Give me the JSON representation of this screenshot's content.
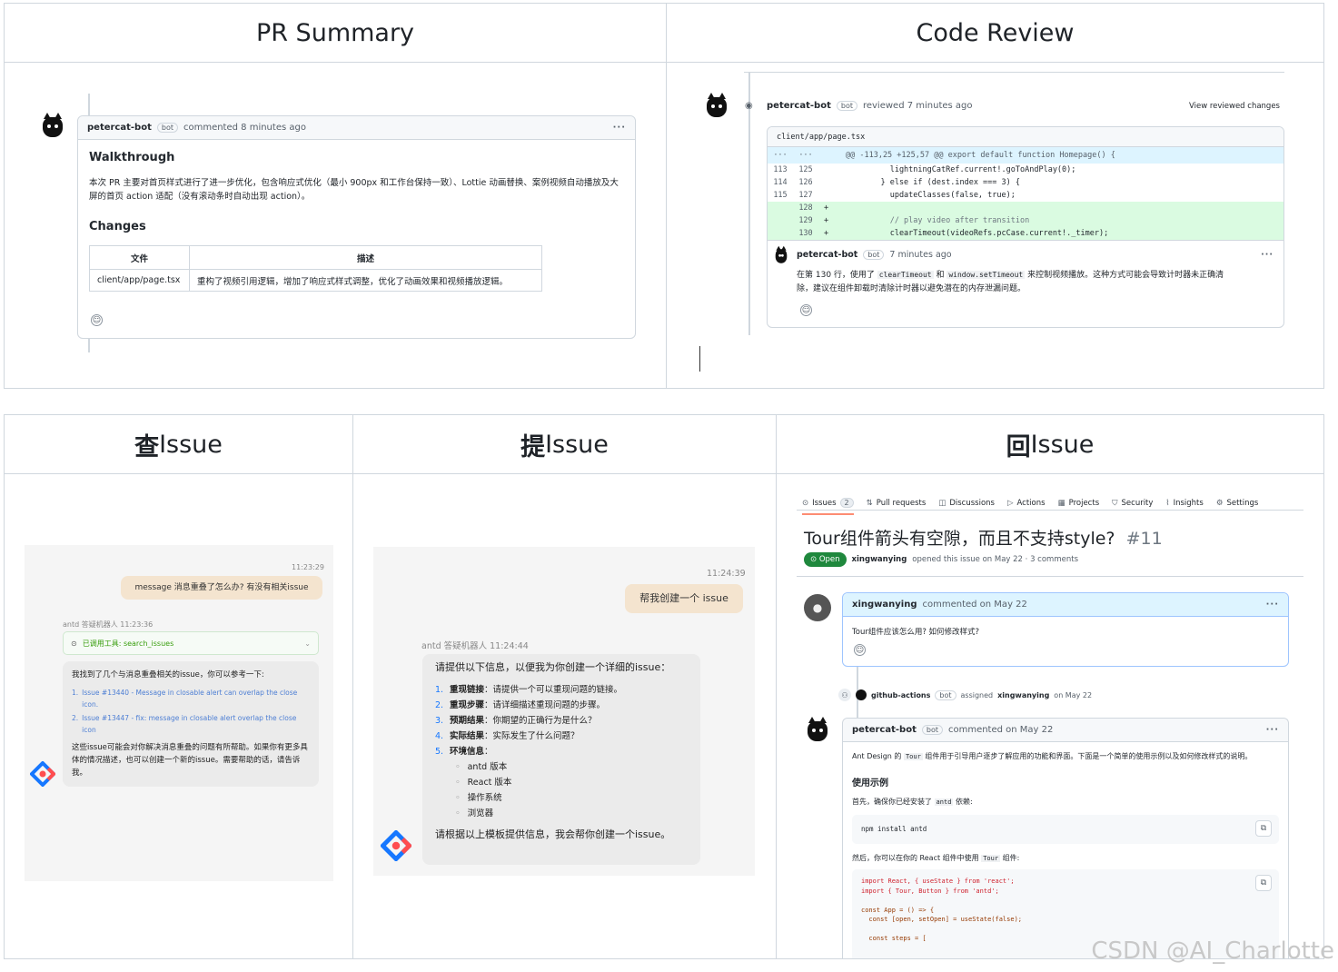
{
  "top": {
    "headers": [
      "PR Summary",
      "Code Review"
    ],
    "pr": {
      "user": "petercat-bot",
      "bot_badge": "bot",
      "action": "commented 8 minutes ago",
      "walkthrough_title": "Walkthrough",
      "walkthrough_text": "本次 PR 主要对首页样式进行了进一步优化，包含响应式优化（最小 900px 和工作台保持一致）、Lottie 动画替换、案例视频自动播放及大屏的首页 action 适配（没有滚动条时自动出现 action）。",
      "changes_title": "Changes",
      "table_headers": [
        "文件",
        "描述"
      ],
      "table_row": [
        "client/app/page.tsx",
        "重构了视频引用逻辑，增加了响应式样式调整，优化了动画效果和视频播放逻辑。"
      ],
      "dots": "···",
      "smile": "☺"
    },
    "review": {
      "user": "petercat-bot",
      "bot_badge": "bot",
      "action": "reviewed 7 minutes ago",
      "view_link": "View reviewed changes",
      "file": "client/app/page.tsx",
      "hunk_left": "···",
      "hunk_right": "···",
      "hunk": "@@ -113,25 +125,57 @@ export default function Homepage() {",
      "lines": [
        {
          "a": "113",
          "b": "125",
          "sign": "",
          "code": "      lightningCatRef.current!.goToAndPlay(0);"
        },
        {
          "a": "114",
          "b": "126",
          "sign": "",
          "code": "    } else if (dest.index === 3) {"
        },
        {
          "a": "115",
          "b": "127",
          "sign": "",
          "code": "      updateClasses(false, true);"
        },
        {
          "a": "",
          "b": "128",
          "sign": "+",
          "code": ""
        },
        {
          "a": "",
          "b": "129",
          "sign": "+",
          "code": "      // play video after transition"
        },
        {
          "a": "",
          "b": "130",
          "sign": "+",
          "code": "      clearTimeout(videoRefs.pcCase.current!._timer);"
        }
      ],
      "comment_user": "petercat-bot",
      "comment_time": "7 minutes ago",
      "comment_text_1": "在第 130 行，使用了",
      "code_a": "clearTimeout",
      "comment_and": "和",
      "code_b": "window.setTimeout",
      "comment_text_2": "来控制视频播放。这种方式可能会导致计时器未正确清",
      "comment_text_3": "除，建议在组件卸载时清除计时器以避免潜在的内存泄漏问题。",
      "dots": "···",
      "smile": "☺"
    }
  },
  "bottom": {
    "headers": [
      {
        "glyph": "查",
        "text": " Issue"
      },
      {
        "glyph": "提",
        "text": " Issue"
      },
      {
        "glyph": "回",
        "text": " Issue"
      }
    ],
    "query": {
      "time_user": "11:23:29",
      "user_msg": "message 消息重叠了怎么办? 有没有相关issue",
      "bot_label": "antd 答疑机器人 11:23:36",
      "tool_label": "已调用工具: search_issues",
      "intro": "我找到了几个与消息重叠相关的issue，你可以参考一下:",
      "items": [
        {
          "num": "1.",
          "text": "Issue #13440 - Message in closable alert can overlap the close icon."
        },
        {
          "num": "2.",
          "text": "Issue #13447 - fix: message in closable alert overlap the close icon"
        }
      ],
      "outro": "这些issue可能会对你解决消息重叠的问题有所帮助。如果你有更多具体的情况描述，也可以创建一个新的issue。需要帮助的话，请告诉我。"
    },
    "create": {
      "time_user": "11:24:39",
      "user_msg": "帮我创建一个 issue",
      "bot_label": "antd 答疑机器人 11:24:44",
      "intro": "请提供以下信息，以便我为你创建一个详细的issue：",
      "items": [
        {
          "num": "1.",
          "bold": "重现链接",
          "text": "：请提供一个可以重现问题的链接。"
        },
        {
          "num": "2.",
          "bold": "重现步骤",
          "text": "：请详细描述重现问题的步骤。"
        },
        {
          "num": "3.",
          "bold": "预期结果",
          "text": "：你期望的正确行为是什么？"
        },
        {
          "num": "4.",
          "bold": "实际结果",
          "text": "：实际发生了什么问题？"
        },
        {
          "num": "5.",
          "bold": "环境信息",
          "text": "："
        }
      ],
      "sub_items": [
        "antd 版本",
        "React 版本",
        "操作系统",
        "浏览器"
      ],
      "outro": "请根据以上模板提供信息，我会帮你创建一个issue。"
    },
    "reply": {
      "tabs": [
        {
          "label": "Issues",
          "count": "2"
        },
        {
          "label": "Pull requests"
        },
        {
          "label": "Discussions"
        },
        {
          "label": "Actions"
        },
        {
          "label": "Projects"
        },
        {
          "label": "Security"
        },
        {
          "label": "Insights"
        },
        {
          "label": "Settings"
        }
      ],
      "title": "Tour组件箭头有空隙，而且不支持style?",
      "number": "#11",
      "state": "Open",
      "meta_user": "xingwanying",
      "meta_text": "opened this issue on May 22 · 3 comments",
      "c1_user": "xingwanying",
      "c1_action": "commented on May 22",
      "c1_text": "Tour组件应该怎么用? 如何修改样式?",
      "event_user": "github-actions",
      "event_badge": "bot",
      "event_text": "assigned",
      "event_target": "xingwanying",
      "event_date": "on May 22",
      "c2_user": "petercat-bot",
      "c2_badge": "bot",
      "c2_action": "commented on May 22",
      "c2_intro_a": "Ant Design 的",
      "c2_intro_code": "Tour",
      "c2_intro_b": "组件用于引导用户逐步了解应用的功能和界面。下面是一个简单的使用示例以及如何修改样式的说明。",
      "c2_heading": "使用示例",
      "c2_first_a": "首先，确保你已经安装了",
      "c2_first_code": "antd",
      "c2_first_b": "依赖:",
      "install_cmd": "npm install antd",
      "c2_then_a": "然后，你可以在你的 React 组件中使用",
      "c2_then_code": "Tour",
      "c2_then_b": "组件:",
      "code_lines": [
        "import React, { useState } from 'react';",
        "import { Tour, Button } from 'antd';",
        "",
        "const App = () => {",
        "  const [open, setOpen] = useState(false);",
        "",
        "  const steps = ["
      ],
      "dots": "···"
    }
  },
  "watermark": "CSDN @AI_Charlotte"
}
